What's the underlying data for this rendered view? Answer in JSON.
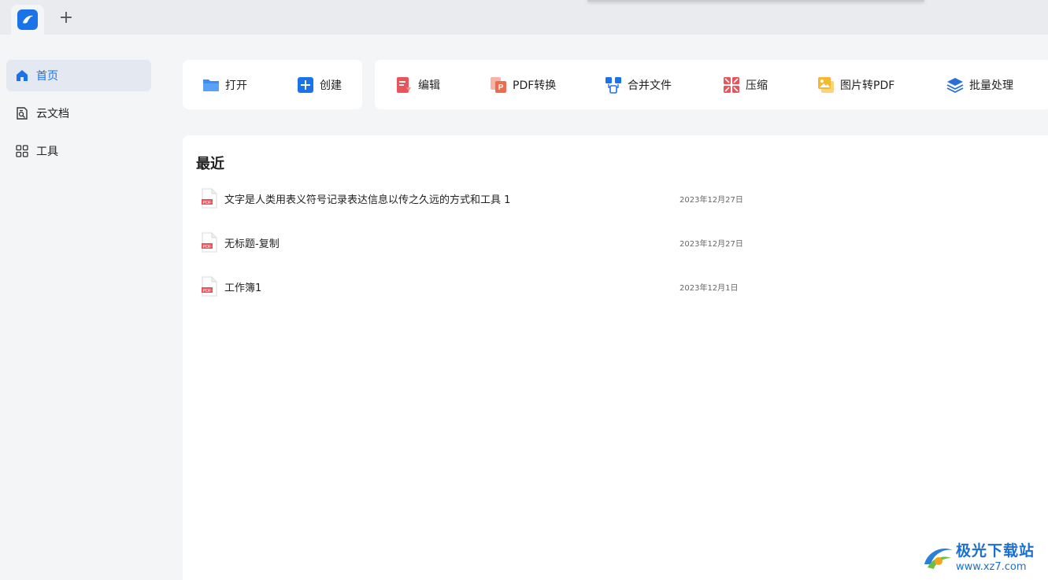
{
  "titlebar": {
    "add_tab_label": "+",
    "app_icon": "app-logo-icon"
  },
  "sidebar": {
    "items": [
      {
        "label": "首页",
        "icon": "home-icon",
        "active": true
      },
      {
        "label": "云文档",
        "icon": "cloud-doc-icon",
        "active": false
      },
      {
        "label": "工具",
        "icon": "grid-tools-icon",
        "active": false
      }
    ]
  },
  "quick_actions": [
    {
      "label": "打开",
      "icon": "folder-open-icon"
    },
    {
      "label": "创建",
      "icon": "plus-square-icon"
    }
  ],
  "tools": [
    {
      "label": "编辑",
      "icon": "edit-doc-icon"
    },
    {
      "label": "PDF转换",
      "icon": "pdf-convert-icon"
    },
    {
      "label": "合并文件",
      "icon": "merge-files-icon"
    },
    {
      "label": "压缩",
      "icon": "compress-icon"
    },
    {
      "label": "图片转PDF",
      "icon": "image-to-pdf-icon"
    },
    {
      "label": "批量处理",
      "icon": "batch-layers-icon"
    }
  ],
  "recent": {
    "title": "最近",
    "files": [
      {
        "name": "文字是人类用表义符号记录表达信息以传之久远的方式和工具 1",
        "date": "2023年12月27日"
      },
      {
        "name": "无标题-复制",
        "date": "2023年12月27日"
      },
      {
        "name": "工作簿1",
        "date": "2023年12月1日"
      }
    ]
  },
  "watermark": {
    "main": "极光下载站",
    "sub": "www.xz7.com"
  },
  "colors": {
    "accent": "#1a73e8",
    "pdf_red": "#e8545c",
    "sidebar_active_bg": "#e4e8f1",
    "background": "#f4f5f7"
  }
}
